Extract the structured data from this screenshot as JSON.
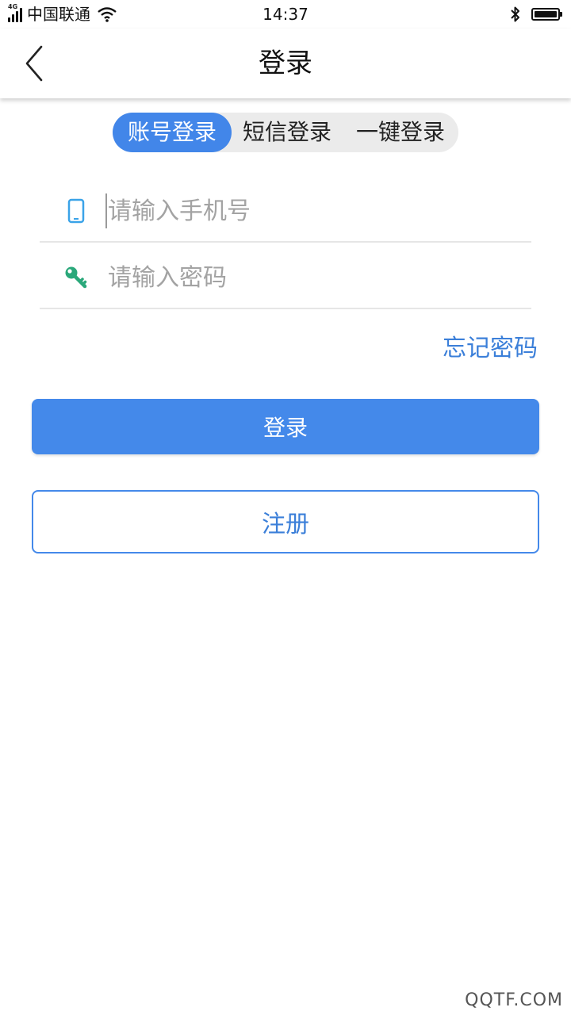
{
  "status_bar": {
    "network": "4G",
    "carrier": "中国联通",
    "time": "14:37"
  },
  "nav": {
    "title": "登录"
  },
  "tabs": [
    {
      "label": "账号登录",
      "active": true
    },
    {
      "label": "短信登录",
      "active": false
    },
    {
      "label": "一键登录",
      "active": false
    }
  ],
  "form": {
    "phone_placeholder": "请输入手机号",
    "phone_value": "",
    "password_placeholder": "请输入密码",
    "password_value": "",
    "forgot_label": "忘记密码"
  },
  "buttons": {
    "login": "登录",
    "register": "注册"
  },
  "watermark": "QQTF.COM",
  "colors": {
    "accent": "#4489ea",
    "link": "#3b7fd9",
    "phone_icon": "#3aa3e8",
    "key_icon": "#2aa87a"
  },
  "icons": {
    "back": "chevron-left-icon",
    "phone": "phone-icon",
    "password": "key-icon"
  }
}
